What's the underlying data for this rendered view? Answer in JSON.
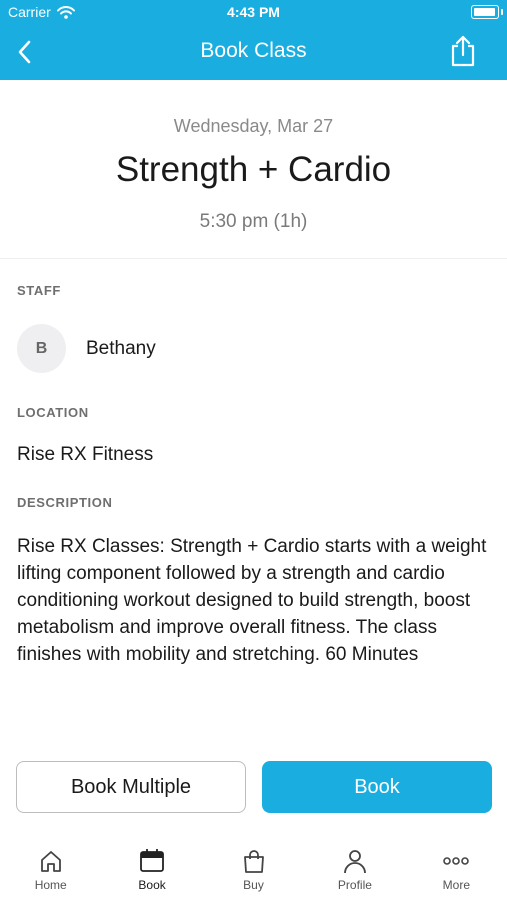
{
  "status_bar": {
    "carrier": "Carrier",
    "time": "4:43 PM"
  },
  "nav": {
    "title": "Book Class"
  },
  "class_info": {
    "date": "Wednesday, Mar 27",
    "title": "Strength + Cardio",
    "time_slot": "5:30 pm (1h)"
  },
  "staff": {
    "label": "STAFF",
    "initial": "B",
    "name": "Bethany"
  },
  "location": {
    "label": "LOCATION",
    "value": "Rise RX Fitness"
  },
  "description": {
    "label": "DESCRIPTION",
    "text": "Rise RX Classes: Strength + Cardio starts with a weight lifting component followed by a strength and cardio conditioning workout designed to build strength, boost metabolism and improve overall fitness. The class finishes with mobility and stretching. 60 Minutes"
  },
  "actions": {
    "book_multiple": "Book Multiple",
    "book": "Book"
  },
  "tabs": [
    {
      "label": "Home",
      "icon": "home-icon"
    },
    {
      "label": "Book",
      "icon": "calendar-icon",
      "active": true
    },
    {
      "label": "Buy",
      "icon": "shopping-bag-icon"
    },
    {
      "label": "Profile",
      "icon": "person-icon"
    },
    {
      "label": "More",
      "icon": "more-dots-icon"
    }
  ],
  "colors": {
    "accent": "#1aaee0"
  }
}
